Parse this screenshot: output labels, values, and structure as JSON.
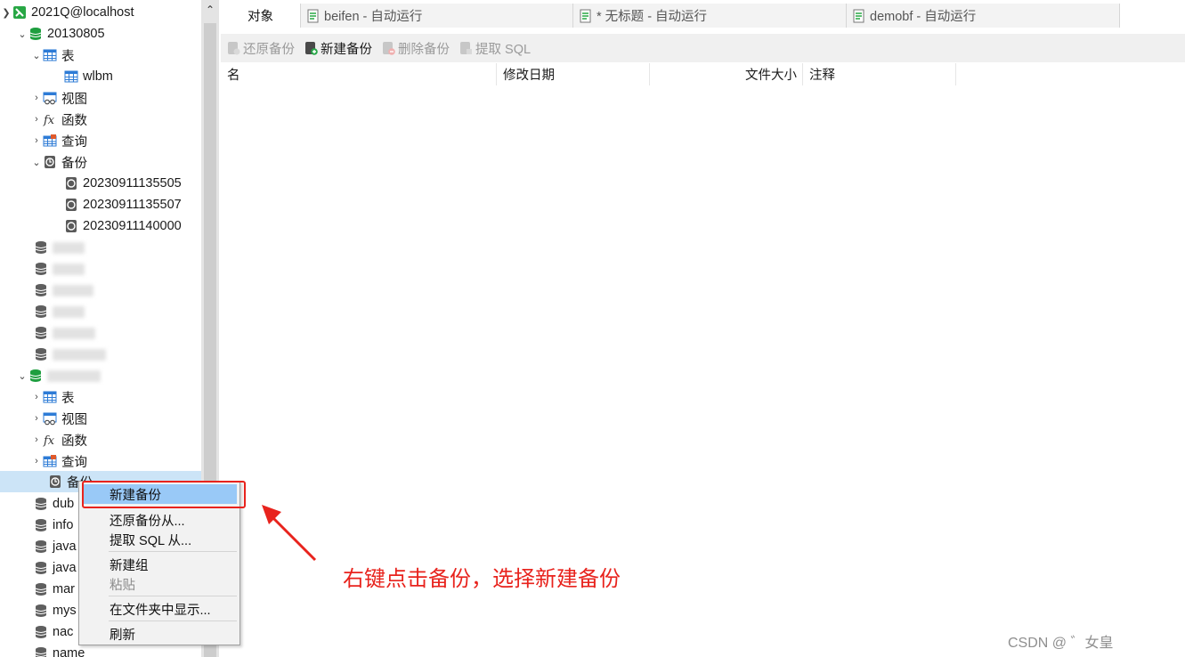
{
  "tree": {
    "connection": "2021Q@localhost",
    "db1": {
      "name": "20130805",
      "tables_label": "表",
      "table_item": "wlbm",
      "views_label": "视图",
      "functions_label": "函数",
      "queries_label": "查询",
      "backups_label": "备份",
      "backup_items": [
        "20230911135505",
        "20230911135507",
        "20230911140000"
      ]
    },
    "db2": {
      "tables_label": "表",
      "views_label": "视图",
      "functions_label": "函数",
      "queries_label": "查询",
      "backups_label": "备份"
    },
    "lower_dbs": [
      "dub",
      "info",
      "java",
      "java",
      "mar",
      "mys",
      "nac",
      "name"
    ]
  },
  "tabs": [
    {
      "label": "对象"
    },
    {
      "label": "beifen - 自动运行"
    },
    {
      "label": "* 无标题 - 自动运行"
    },
    {
      "label": "demobf - 自动运行"
    }
  ],
  "toolbar": {
    "restore": "还原备份",
    "new_backup": "新建备份",
    "delete": "删除备份",
    "extract": "提取 SQL"
  },
  "grid": {
    "columns": [
      "名",
      "修改日期",
      "文件大小",
      "注释"
    ]
  },
  "context_menu": {
    "items": [
      "新建备份",
      "还原备份从...",
      "提取 SQL 从...",
      "新建组",
      "粘贴",
      "在文件夹中显示...",
      "刷新"
    ],
    "highlighted": "新建备份",
    "disabled": [
      "粘贴"
    ]
  },
  "annotation": {
    "text": "右键点击备份，选择新建备份",
    "color": "#e8231d"
  },
  "watermark": "CSDN @ ゛女皇"
}
